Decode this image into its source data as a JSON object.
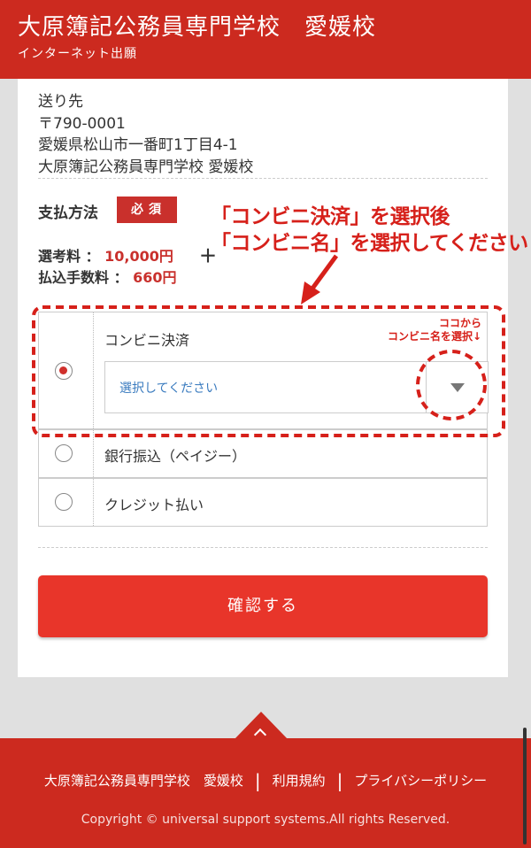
{
  "header": {
    "title": "大原簿記公務員専門学校　愛媛校",
    "subtitle": "インターネット出願"
  },
  "address": {
    "lines": [
      "送り先",
      "〒790-0001",
      "愛媛県松山市一番町1丁目4-1",
      "大原簿記公務員専門学校 愛媛校"
    ]
  },
  "payment": {
    "label": "支払方法",
    "required_badge": "必須",
    "exam_fee_label": "選考料 ：",
    "exam_fee_value": "10,000円",
    "plus": "＋",
    "transfer_fee_label": "払込手数料 ：",
    "transfer_fee_value": "660円",
    "options": [
      {
        "label": "コンビニ決済",
        "selected": true
      },
      {
        "label": "銀行振込（ペイジー）",
        "selected": false
      },
      {
        "label": "クレジット払い",
        "selected": false
      }
    ],
    "select_placeholder": "選択してください"
  },
  "annotations": {
    "main_line1": "「コンビニ決済」を選択後",
    "main_line2": "「コンビニ名」を選択してください",
    "hint_line1": "ココから",
    "hint_line2": "コンビニ名を選択↓"
  },
  "confirm_button": "確認する",
  "footer": {
    "links": [
      "大原簿記公務員専門学校　愛媛校",
      "利用規約",
      "プライバシーポリシー"
    ],
    "copyright": "Copyright © universal support systems.All rights Reserved."
  },
  "colors": {
    "brand_red": "#cc2a1f",
    "button_red": "#e8352a",
    "annotation_red": "#d6201a",
    "link_blue": "#3a7bbf"
  }
}
